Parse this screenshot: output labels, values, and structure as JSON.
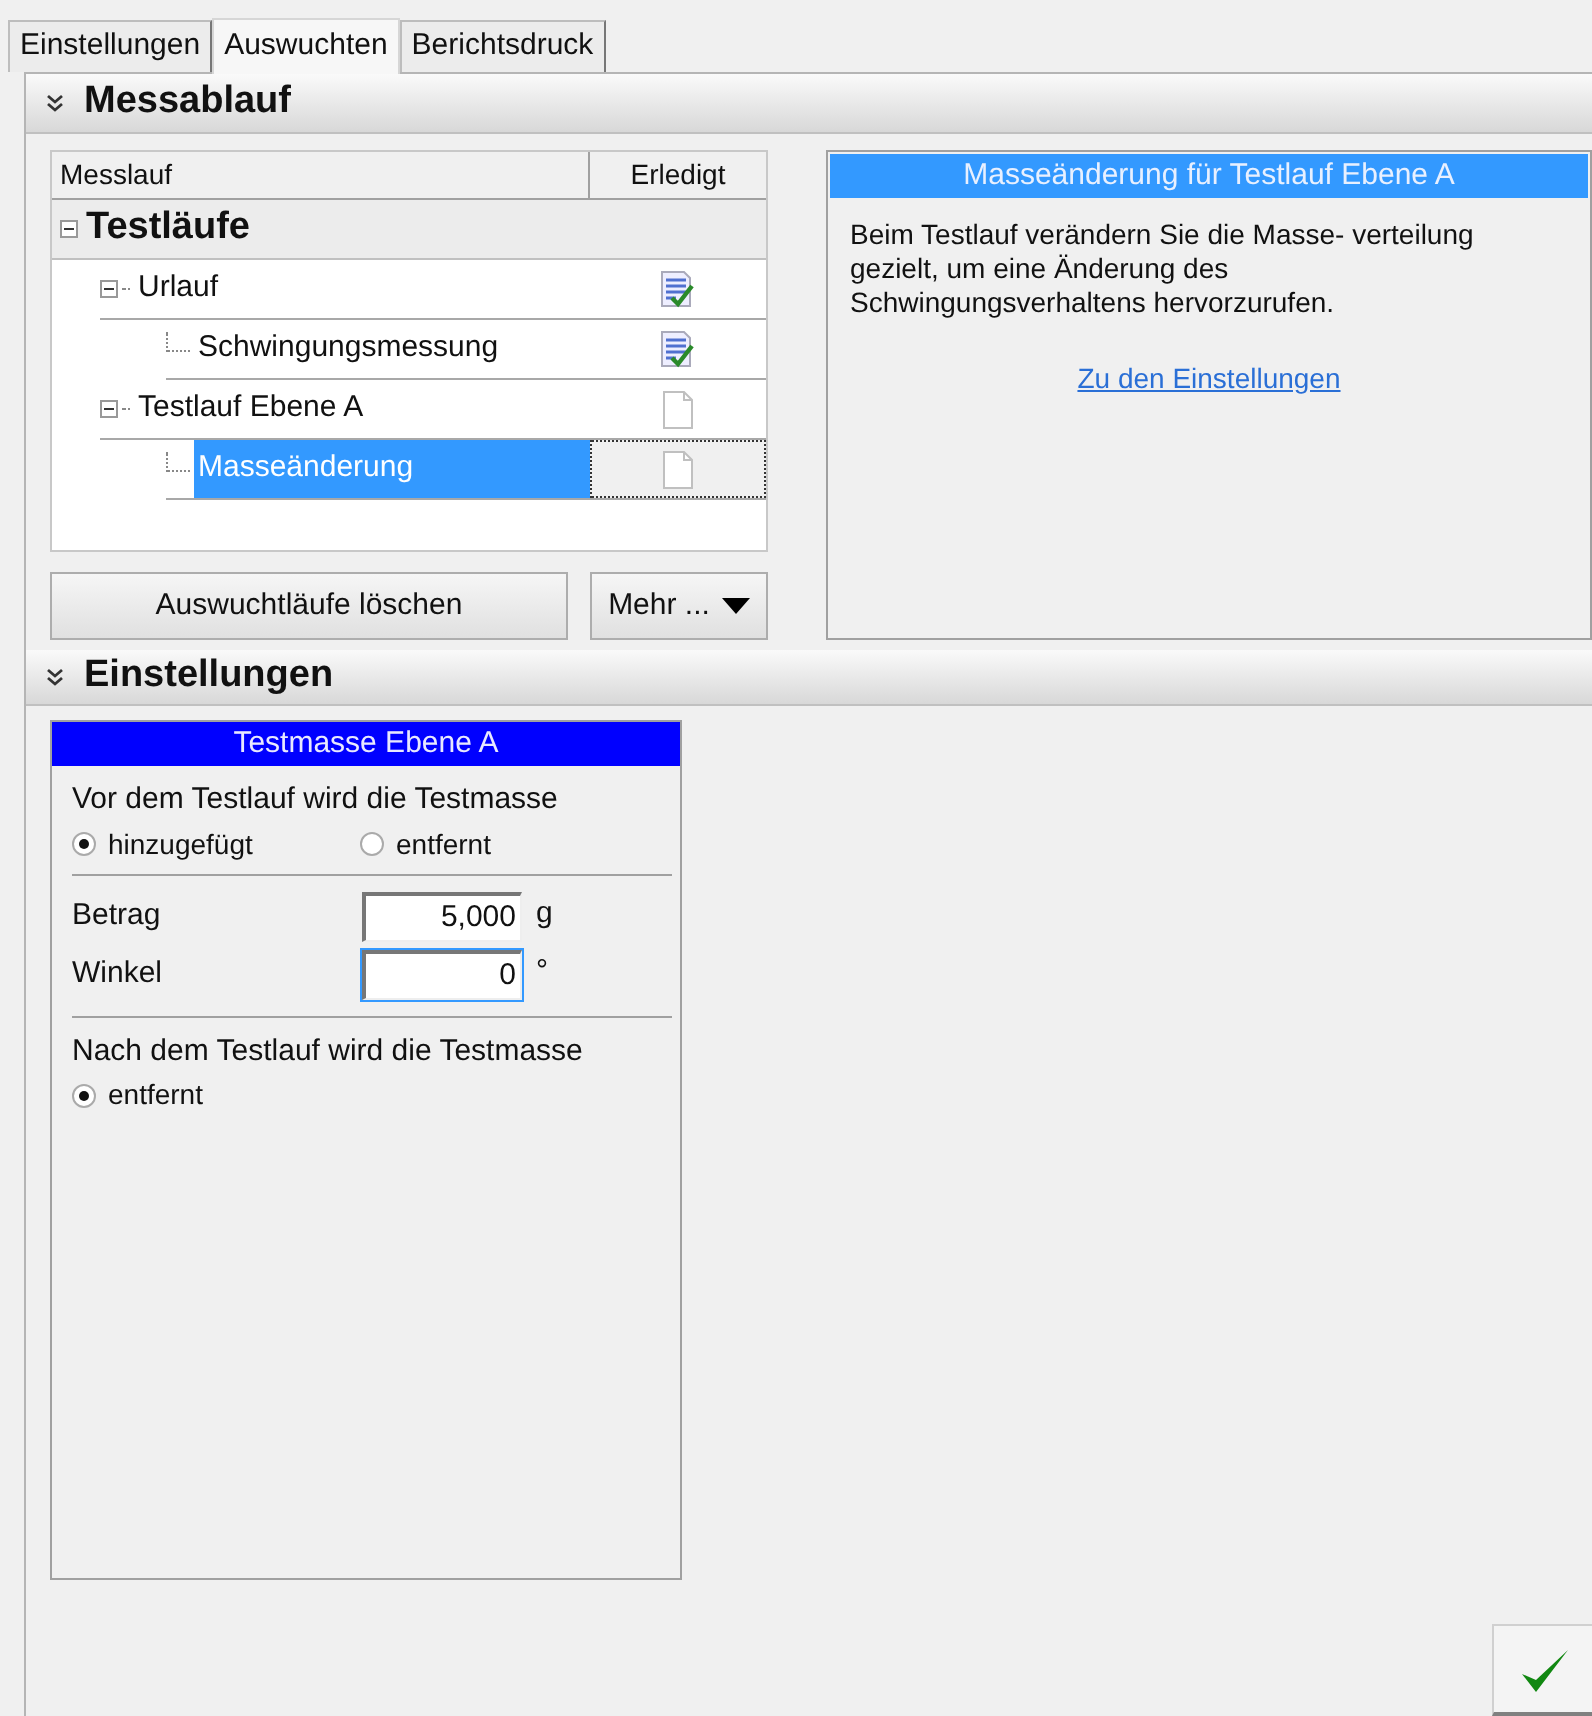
{
  "tabs": [
    {
      "label": "Einstellungen",
      "selected": false
    },
    {
      "label": "Auswuchten",
      "selected": true
    },
    {
      "label": "Berichtsdruck",
      "selected": false
    }
  ],
  "messablauf": {
    "title": "Messablauf",
    "expanded": true,
    "tree": {
      "columns": [
        "Messlauf",
        "Erledigt"
      ],
      "root": {
        "label": "Testläufe",
        "expanded": true,
        "children": [
          {
            "label": "Urlauf",
            "expanded": true,
            "done": true,
            "selected": false,
            "children": [
              {
                "label": "Schwingungsmessung",
                "done": true,
                "selected": false
              }
            ]
          },
          {
            "label": "Testlauf Ebene A",
            "expanded": true,
            "done": false,
            "selected": false,
            "children": [
              {
                "label": "Masseänderung",
                "done": false,
                "selected": true
              }
            ]
          }
        ]
      }
    },
    "buttons": [
      {
        "label": "Auswuchtläufe löschen",
        "kind": "plain"
      },
      {
        "label": "Mehr ...",
        "kind": "dropdown"
      }
    ],
    "info": {
      "title": "Masseänderung für Testlauf Ebene A",
      "text": "Beim Testlauf verändern Sie die Masse- verteilung gezielt, um eine Änderung des Schwingungsverhaltens hervorzurufen.",
      "link": "Zu den Einstellungen"
    }
  },
  "einstellungen": {
    "title": "Einstellungen",
    "expanded": true,
    "card": {
      "title": "Testmasse Ebene A",
      "before": {
        "label": "Vor dem Testlauf wird die Testmasse",
        "options": [
          {
            "label": "hinzugefügt",
            "selected": true
          },
          {
            "label": "entfernt",
            "selected": false
          }
        ]
      },
      "fields": [
        {
          "label": "Betrag",
          "value": "5,000",
          "unit": "g",
          "focused": false
        },
        {
          "label": "Winkel",
          "value": "0",
          "unit": "°",
          "focused": true
        }
      ],
      "after": {
        "label": "Nach dem Testlauf wird die Testmasse",
        "options": [
          {
            "label": "entfernt",
            "selected": true
          }
        ]
      }
    }
  },
  "ok_button": {
    "kind": "check"
  }
}
